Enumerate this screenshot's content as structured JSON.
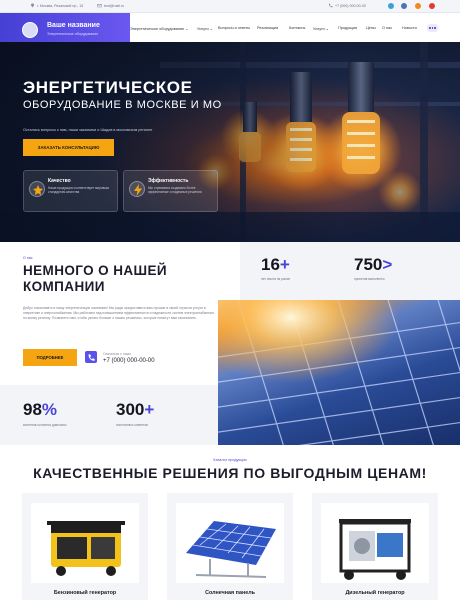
{
  "topbar": {
    "address": "г. Москва, Рязанский пр., 15",
    "email": "test@mail.ru",
    "phone": "+7 (000) 000-00-00",
    "socials": [
      "telegram-icon",
      "vk-icon",
      "ok-icon",
      "youtube-icon"
    ]
  },
  "header": {
    "logo_title": "Ваше название",
    "logo_subtitle": "Энергетическое оборудование",
    "nav": [
      {
        "label": "Энергетическое оборудование ⌄"
      },
      {
        "label": "Услуги ⌄"
      },
      {
        "label": "Вопросы и ответы"
      },
      {
        "label": "Реализация"
      },
      {
        "label": "Контакты"
      },
      {
        "label": "Услуги ⌄"
      },
      {
        "label": "Продукция"
      },
      {
        "label": "Цены"
      },
      {
        "label": "О нас"
      },
      {
        "label": "Новости"
      }
    ]
  },
  "hero": {
    "title_line1": "ЭНЕРГЕТИЧЕСКОЕ",
    "title_line2": "ОБОРУДОВАНИЕ В МОСКВЕ И МО",
    "description": "Остались вопросы к нам, наши заказчики и Шадов в московском регионе",
    "button": "ЗАКАЗАТЬ КОНСУЛЬТАЦИЮ",
    "features": [
      {
        "title": "Качество",
        "text": "Наша продукция соответствует мировым стандартам качества",
        "icon": "quality-icon"
      },
      {
        "title": "Эффективность",
        "text": "Мы стремимся создавать более эффективные и надежные решения",
        "icon": "efficiency-icon"
      }
    ]
  },
  "about": {
    "kicker": "О нас",
    "title": "НЕМНОГО О НАШЕЙ КОМПАНИИ",
    "text": "Добро пожаловать в нашу энергетическую компанию! Мы рады предоставить вам лучшие в своей отрасли услуги в энергетике и энергоснабжении. Мы работаем над повышением эффективности и надежности систем электроснабжения по всему региону. Позвоните нам, чтобы узнать больше о наших решениях, которые помогут вам сэкономить.",
    "button": "ПОДРОБНЕЕ",
    "phone_label": "Связаться с нами",
    "phone": "+7 (000) 000-00-00"
  },
  "stats": [
    {
      "value": "16",
      "suffix": "+",
      "label": "лет опыта на рынке"
    },
    {
      "value": "750",
      "suffix": ">",
      "label": "проектов выполнено"
    },
    {
      "value": "98",
      "suffix": "%",
      "label": "клиентов остаются довольны"
    },
    {
      "value": "300",
      "suffix": "+",
      "label": "постоянных клиентов"
    }
  ],
  "catalog": {
    "kicker": "Каталог продукции",
    "title": "КАЧЕСТВЕННЫЕ РЕШЕНИЯ ПО ВЫГОДНЫМ ЦЕНАМ!",
    "items": [
      {
        "name": "Бензиновый генератор",
        "icon": "gasoline-generator-image"
      },
      {
        "name": "Солнечная панель",
        "icon": "solar-panel-image"
      },
      {
        "name": "Дизельный генератор",
        "icon": "diesel-generator-image"
      }
    ]
  },
  "colors": {
    "accent": "#4b45d6",
    "button": "#f5a511",
    "hero_dark": "#0c1428"
  }
}
